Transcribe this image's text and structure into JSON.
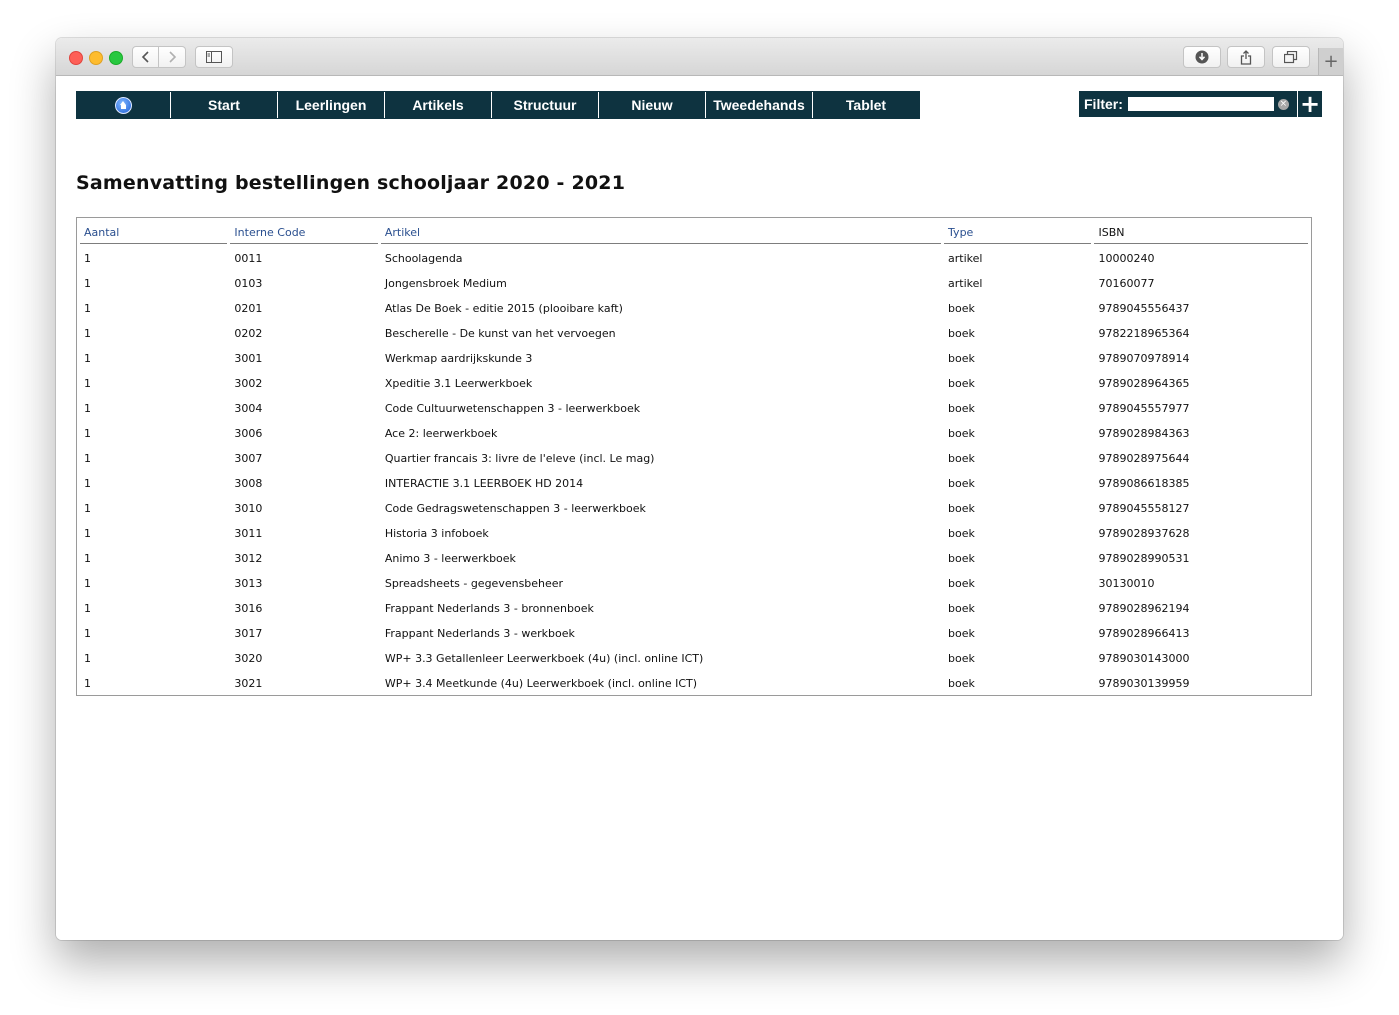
{
  "nav": {
    "items": [
      "Start",
      "Leerlingen",
      "Artikels",
      "Structuur",
      "Nieuw",
      "Tweedehands",
      "Tablet"
    ],
    "filter_label": "Filter:",
    "filter_value": "",
    "filter_clear": "×",
    "filter_add": "+"
  },
  "page": {
    "title": "Samenvatting bestellingen schooljaar 2020 - 2021"
  },
  "table": {
    "headers": [
      "Aantal",
      "Interne Code",
      "Artikel",
      "Type",
      "ISBN"
    ],
    "rows": [
      [
        "1",
        "0011",
        "Schoolagenda",
        "artikel",
        "10000240"
      ],
      [
        "1",
        "0103",
        "Jongensbroek Medium",
        "artikel",
        "70160077"
      ],
      [
        "1",
        "0201",
        "Atlas De Boek - editie 2015 (plooibare kaft)",
        "boek",
        "9789045556437"
      ],
      [
        "1",
        "0202",
        "Bescherelle - De kunst van het vervoegen",
        "boek",
        "9782218965364"
      ],
      [
        "1",
        "3001",
        "Werkmap aardrijkskunde 3",
        "boek",
        "9789070978914"
      ],
      [
        "1",
        "3002",
        "Xpeditie 3.1 Leerwerkboek",
        "boek",
        "9789028964365"
      ],
      [
        "1",
        "3004",
        "Code Cultuurwetenschappen 3 - leerwerkboek",
        "boek",
        "9789045557977"
      ],
      [
        "1",
        "3006",
        "Ace 2: leerwerkboek",
        "boek",
        "9789028984363"
      ],
      [
        "1",
        "3007",
        "Quartier francais 3: livre de l'eleve (incl. Le mag)",
        "boek",
        "9789028975644"
      ],
      [
        "1",
        "3008",
        "INTERACTIE 3.1 LEERBOEK HD 2014",
        "boek",
        "9789086618385"
      ],
      [
        "1",
        "3010",
        "Code Gedragswetenschappen 3 - leerwerkboek",
        "boek",
        "9789045558127"
      ],
      [
        "1",
        "3011",
        "Historia 3 infoboek",
        "boek",
        "9789028937628"
      ],
      [
        "1",
        "3012",
        "Animo 3 - leerwerkboek",
        "boek",
        "9789028990531"
      ],
      [
        "1",
        "3013",
        "Spreadsheets - gegevensbeheer",
        "boek",
        "30130010"
      ],
      [
        "1",
        "3016",
        "Frappant Nederlands 3 - bronnenboek",
        "boek",
        "9789028962194"
      ],
      [
        "1",
        "3017",
        "Frappant Nederlands 3 - werkboek",
        "boek",
        "9789028966413"
      ],
      [
        "1",
        "3020",
        "WP+ 3.3 Getallenleer Leerwerkboek (4u) (incl. online ICT)",
        "boek",
        "9789030143000"
      ],
      [
        "1",
        "3021",
        "WP+ 3.4 Meetkunde (4u) Leerwerkboek (incl. online ICT)",
        "boek",
        "9789030139959"
      ]
    ]
  },
  "browser": {
    "new_tab": "+"
  },
  "icons": [
    "home-icon",
    "back-icon",
    "forward-icon",
    "sidebar-icon",
    "download-icon",
    "share-icon",
    "tabs-icon",
    "clear-icon",
    "add-icon"
  ],
  "colors": {
    "menu_bg": "#0e3340",
    "header_link": "#2a4f8f"
  }
}
